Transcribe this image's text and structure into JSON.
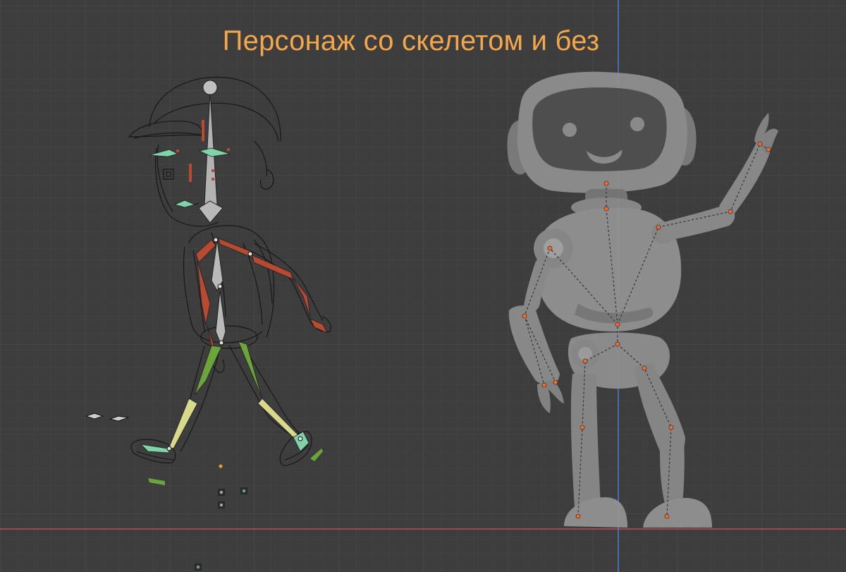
{
  "viewport": {
    "title": "Персонаж со скелетом и без"
  },
  "colors": {
    "background": "#3d3d3d",
    "title": "#f3a64a",
    "bone_red": "#b84a32",
    "bone_green": "#6aa43a",
    "bone_mint": "#7ed4a8",
    "bone_yellow": "#d8d98a",
    "bone_grey": "#b9b9b9",
    "joint_orange": "#ff6a1f",
    "axis_red": "#c84a55",
    "axis_blue": "#4d7bd6",
    "robot_body": "#8a8a8a"
  },
  "icons": [
    "bone-icon",
    "empty-object-icon",
    "origin-point-icon"
  ]
}
